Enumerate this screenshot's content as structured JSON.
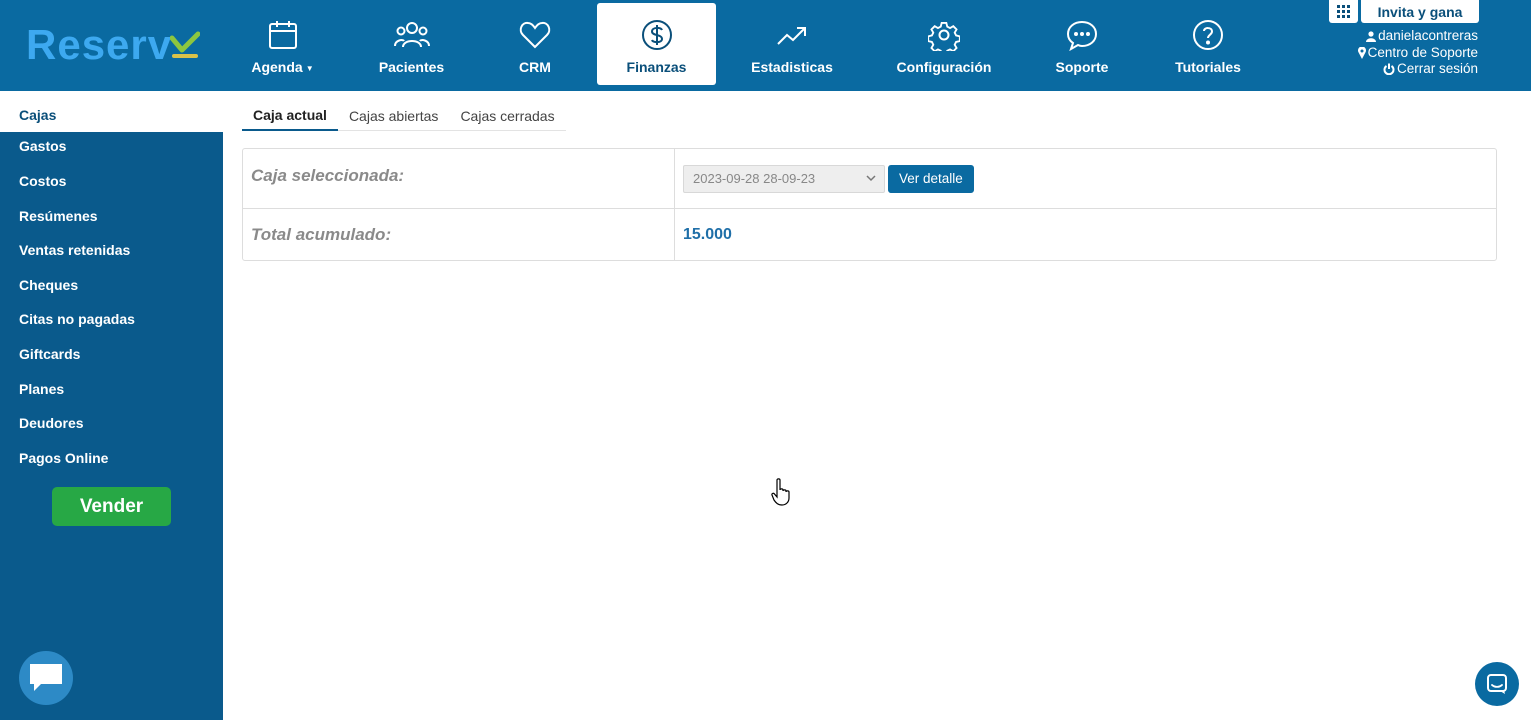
{
  "logo": {
    "text": "Reserv",
    "check_color": "#8cc63f"
  },
  "nav": [
    {
      "label": "Agenda",
      "icon": "calendar-icon",
      "has_caret": true
    },
    {
      "label": "Pacientes",
      "icon": "users-icon"
    },
    {
      "label": "CRM",
      "icon": "heart-icon"
    },
    {
      "label": "Finanzas",
      "icon": "dollar-circle-icon",
      "active": true
    },
    {
      "label": "Estadisticas",
      "icon": "trending-up-icon"
    },
    {
      "label": "Configuración",
      "icon": "gear-icon"
    },
    {
      "label": "Soporte",
      "icon": "chat-bubble-icon"
    },
    {
      "label": "Tutoriales",
      "icon": "question-circle-icon"
    }
  ],
  "topright": {
    "apps_icon": "grid-icon",
    "invite_label": "Invita y gana",
    "username": "danielacontreras",
    "support_center": "Centro de Soporte",
    "logout": "Cerrar sesión"
  },
  "sidebar": {
    "items": [
      {
        "label": "Cajas",
        "active": true
      },
      {
        "label": "Gastos"
      },
      {
        "label": "Costos"
      },
      {
        "label": "Resúmenes"
      },
      {
        "label": "Ventas retenidas"
      },
      {
        "label": "Cheques"
      },
      {
        "label": "Citas no pagadas"
      },
      {
        "label": "Giftcards"
      },
      {
        "label": "Planes"
      },
      {
        "label": "Deudores"
      },
      {
        "label": "Pagos Online"
      }
    ],
    "sell_button": "Vender"
  },
  "tabs": [
    {
      "label": "Caja actual",
      "active": true
    },
    {
      "label": "Cajas abiertas"
    },
    {
      "label": "Cajas cerradas"
    }
  ],
  "cash": {
    "selected_label": "Caja seleccionada:",
    "selected_value": "2023-09-28 28-09-23",
    "detail_button": "Ver detalle",
    "total_label": "Total acumulado:",
    "total_value": "15.000"
  },
  "colors": {
    "header_bg": "#0a6aa1",
    "sidebar_bg": "#0a5a8c",
    "sell_green": "#27a845",
    "total_blue": "#1f6fa8"
  }
}
